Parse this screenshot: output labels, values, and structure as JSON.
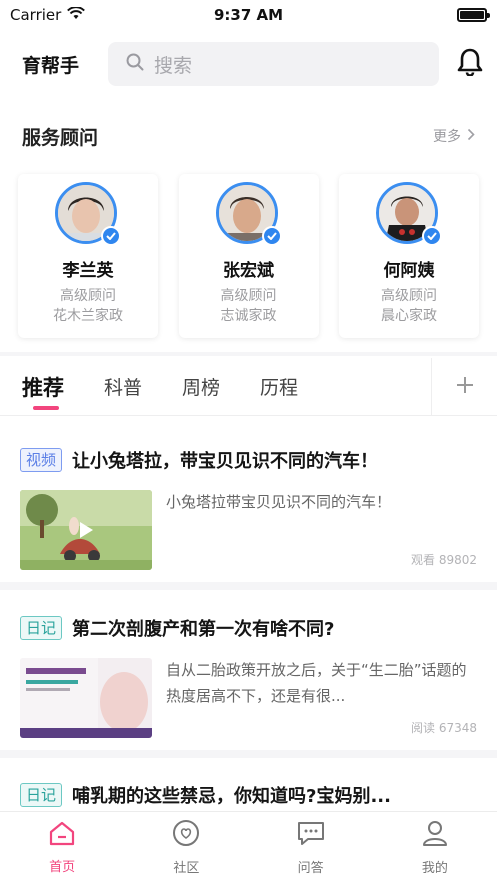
{
  "status_bar": {
    "carrier": "Carrier",
    "time": "9:37 AM",
    "battery_level": 1.0
  },
  "header": {
    "app_name": "育帮手",
    "search_placeholder": "搜索"
  },
  "advisors_section": {
    "title": "服务顾问",
    "more_label": "更多",
    "items": [
      {
        "name": "李兰英",
        "role": "高级顾问",
        "company": "花木兰家政"
      },
      {
        "name": "张宏斌",
        "role": "高级顾问",
        "company": "志诚家政"
      },
      {
        "name": "何阿姨",
        "role": "高级顾问",
        "company": "晨心家政"
      }
    ]
  },
  "tabs": {
    "items": [
      "推荐",
      "科普",
      "周榜",
      "历程"
    ],
    "active": "推荐",
    "add_icon": "plus-icon"
  },
  "articles": [
    {
      "tag": "视频",
      "title": "让小兔塔拉，带宝贝见识不同的汽车！",
      "summary": "小兔塔拉带宝贝见识不同的汽车！",
      "meta": "观看 89802"
    },
    {
      "tag": "日记",
      "title": "第二次剖腹产和第一次有啥不同?",
      "summary": "自从二胎政策开放之后，关于“生二胎”话题的热度居高不下，还是有很...",
      "meta": "阅读 67348"
    },
    {
      "tag": "日记",
      "title": "哺乳期的这些禁忌，你知道吗?宝妈别..."
    }
  ],
  "bottom_nav": {
    "items": [
      {
        "label": "首页",
        "icon": "home-icon"
      },
      {
        "label": "社区",
        "icon": "community-icon"
      },
      {
        "label": "问答",
        "icon": "chat-icon"
      },
      {
        "label": "我的",
        "icon": "profile-icon"
      }
    ],
    "active": "首页"
  },
  "colors": {
    "accent": "#f2457e",
    "verify_blue": "#2f86ef",
    "video_tag": "#5b7fe6",
    "diary_tag": "#2aa39c"
  }
}
